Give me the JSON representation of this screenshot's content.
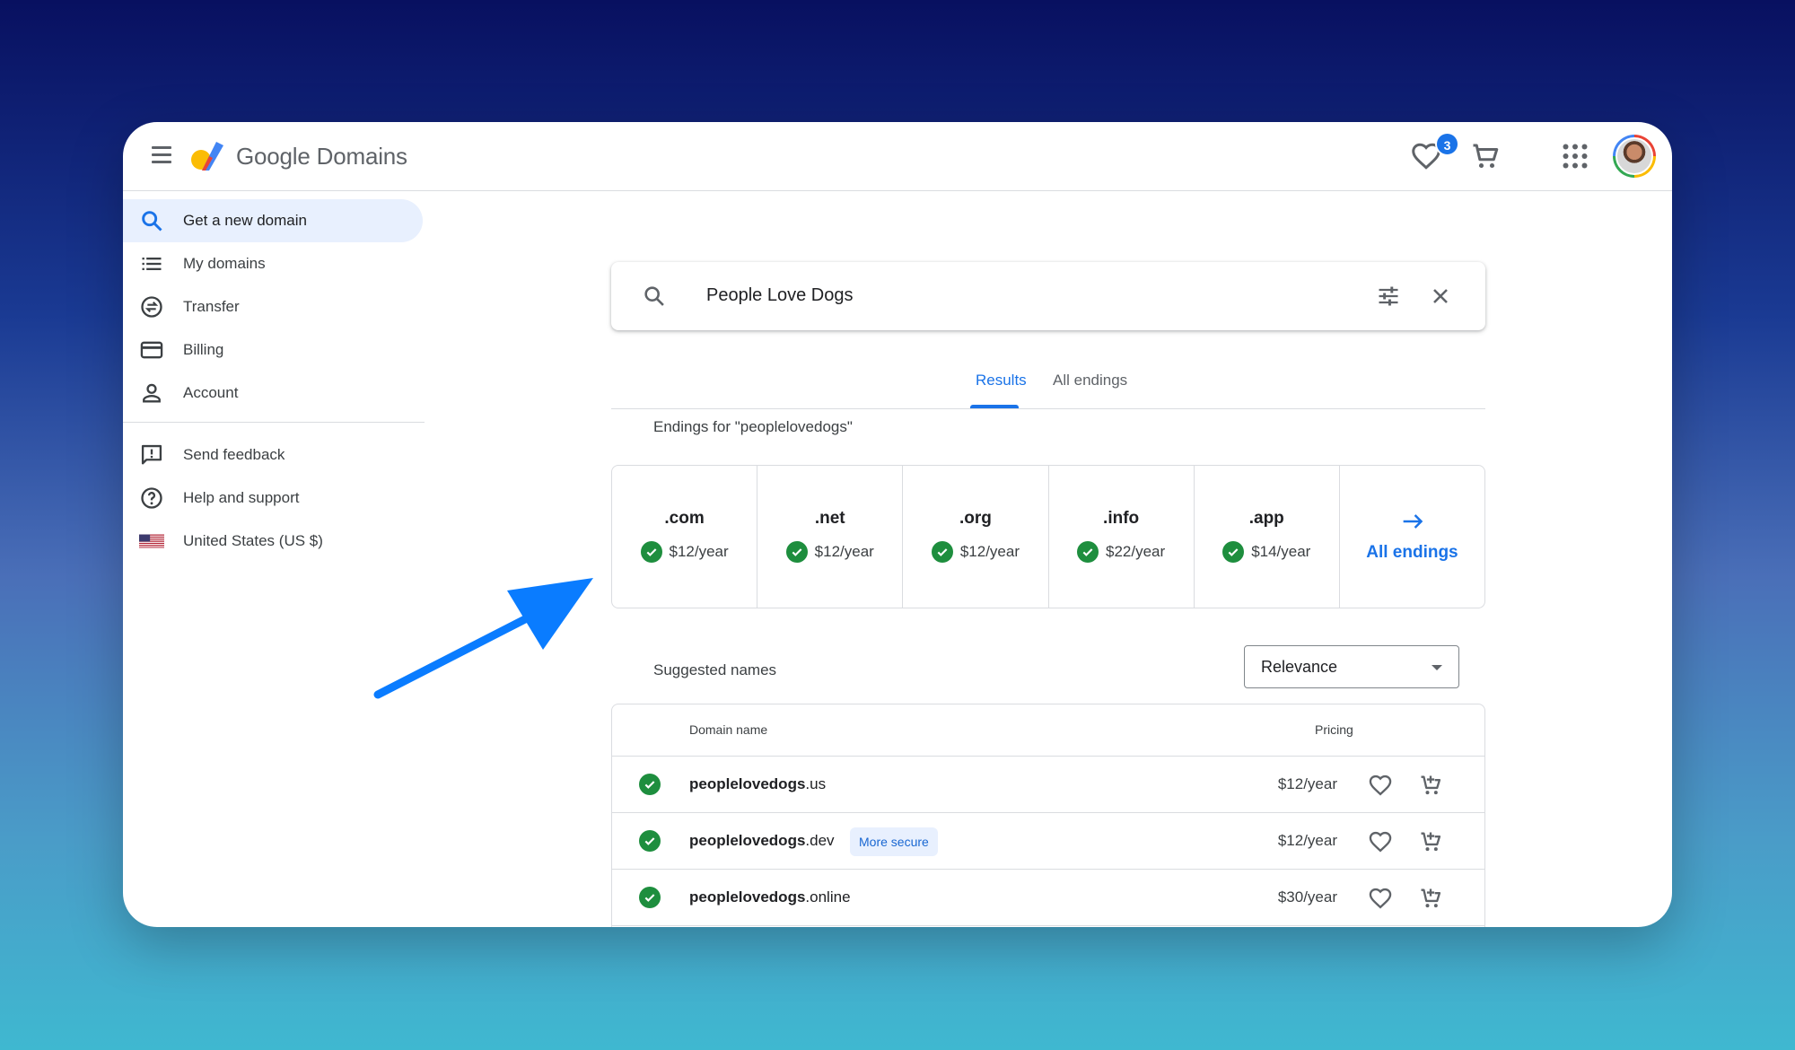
{
  "header": {
    "brand": "Google Domains",
    "favorites_count": "3"
  },
  "sidebar": {
    "items": [
      {
        "label": "Get a new domain",
        "icon": "search-icon"
      },
      {
        "label": "My domains",
        "icon": "list-icon"
      },
      {
        "label": "Transfer",
        "icon": "transfer-icon"
      },
      {
        "label": "Billing",
        "icon": "credit-card-icon"
      },
      {
        "label": "Account",
        "icon": "person-icon"
      }
    ],
    "secondary": [
      {
        "label": "Send feedback",
        "icon": "feedback-icon"
      },
      {
        "label": "Help and support",
        "icon": "help-icon"
      },
      {
        "label": "United States (US $)",
        "icon": "us-flag-icon"
      }
    ]
  },
  "search": {
    "query": "People Love Dogs"
  },
  "tabs": [
    {
      "label": "Results",
      "active": true
    },
    {
      "label": "All endings",
      "active": false
    }
  ],
  "endings": {
    "title": "Endings for \"peoplelovedogs\"",
    "items": [
      {
        "tld": ".com",
        "price": "$12/year"
      },
      {
        "tld": ".net",
        "price": "$12/year"
      },
      {
        "tld": ".org",
        "price": "$12/year"
      },
      {
        "tld": ".info",
        "price": "$22/year"
      },
      {
        "tld": ".app",
        "price": "$14/year"
      }
    ],
    "all_label": "All endings"
  },
  "suggested": {
    "title": "Suggested names",
    "sort": "Relevance",
    "columns": {
      "domain": "Domain name",
      "pricing": "Pricing"
    },
    "rows": [
      {
        "name": "peoplelovedogs",
        "tld": ".us",
        "price": "$12/year",
        "tag": ""
      },
      {
        "name": "peoplelovedogs",
        "tld": ".dev",
        "price": "$12/year",
        "tag": "More secure"
      },
      {
        "name": "peoplelovedogs",
        "tld": ".online",
        "price": "$30/year",
        "tag": ""
      }
    ]
  },
  "colors": {
    "accent": "#1a73e8",
    "available": "#1e8e3e",
    "arrow": "#0a7cff"
  }
}
